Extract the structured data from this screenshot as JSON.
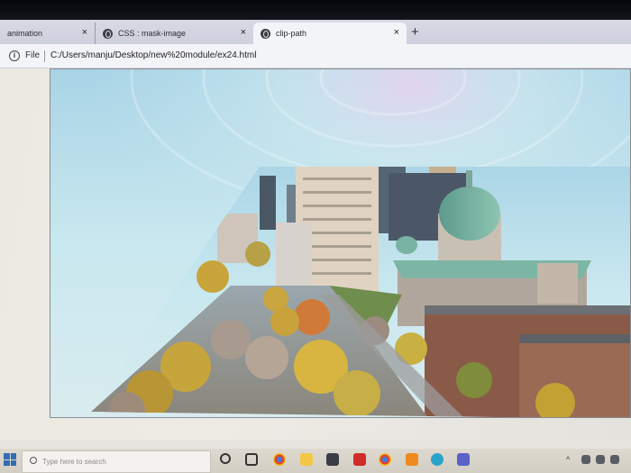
{
  "browser": {
    "tabs": [
      {
        "label": "animation",
        "close": "×"
      },
      {
        "label": "CSS : mask-image",
        "close": "×"
      },
      {
        "label": "clip-path",
        "close": "×"
      }
    ],
    "new_tab": "+",
    "address": {
      "info": "i",
      "scheme_label": "File",
      "url": "C:/Users/manju/Desktop/new%20module/ex24.html"
    }
  },
  "page": {
    "image_description": "city skyline photo clipped to a triangle"
  },
  "taskbar": {
    "search_placeholder": "Type here to search",
    "icons": [
      "cortana-icon",
      "task-view-icon",
      "chrome-icon",
      "file-explorer-icon",
      "store-icon",
      "netflix-icon",
      "chrome-icon",
      "vlc-icon",
      "edge-icon",
      "teams-icon"
    ],
    "tray": {
      "chevron": "^"
    }
  },
  "colors": {
    "tabstrip": "#d7d9e4",
    "active_tab": "#f3f4f8",
    "sky": "#bfe3ef",
    "windows_blue": "#2f6db5"
  }
}
